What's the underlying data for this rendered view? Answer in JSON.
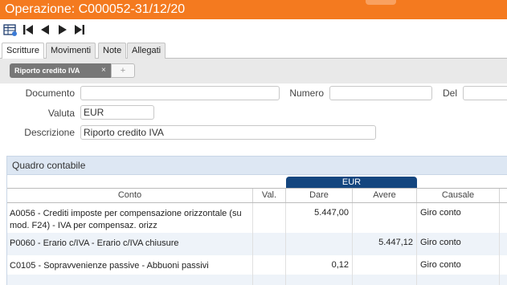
{
  "window": {
    "title": "Operazione: C000052-31/12/20"
  },
  "toolbar": {
    "buttons": [
      {
        "name": "table-view-icon"
      },
      {
        "name": "first-record-icon"
      },
      {
        "name": "previous-record-icon"
      },
      {
        "name": "next-record-icon"
      },
      {
        "name": "last-record-icon"
      }
    ]
  },
  "tabs": [
    {
      "label": "Scritture",
      "active": true
    },
    {
      "label": "Movimenti",
      "active": false
    },
    {
      "label": "Note",
      "active": false
    },
    {
      "label": "Allegati",
      "active": false
    }
  ],
  "subtabs": {
    "active_label": "Riporto credito IVA",
    "close_glyph": "×",
    "add_glyph": "+"
  },
  "form": {
    "documento_label": "Documento",
    "documento_value": "",
    "numero_label": "Numero",
    "numero_value": "",
    "del_label": "Del",
    "del_value": "",
    "valuta_label": "Valuta",
    "valuta_value": "EUR",
    "descrizione_label": "Descrizione",
    "descrizione_value": "Riporto credito IVA"
  },
  "quadro": {
    "title": "Quadro contabile",
    "currency": "EUR",
    "columns": {
      "conto": "Conto",
      "val": "Val.",
      "dare": "Dare",
      "avere": "Avere",
      "causale": "Causale"
    },
    "rows": [
      {
        "conto": "A0056 - Crediti imposte per compensazione orizzontale (su mod. F24) - IVA per compensaz. orizz",
        "val": "",
        "dare": "5.447,00",
        "avere": "",
        "causale": "Giro conto"
      },
      {
        "conto": "P0060 - Erario c/IVA - Erario c/IVA chiusure",
        "val": "",
        "dare": "",
        "avere": "5.447,12",
        "causale": "Giro conto"
      },
      {
        "conto": "C0105 - Sopravvenienze passive - Abbuoni passivi",
        "val": "",
        "dare": "0,12",
        "avere": "",
        "causale": "Giro conto"
      }
    ]
  },
  "colors": {
    "accent": "#f47a1f",
    "header_blue": "#14467f",
    "panel_header": "#dde7f3",
    "stripe": "#eef3f9"
  }
}
